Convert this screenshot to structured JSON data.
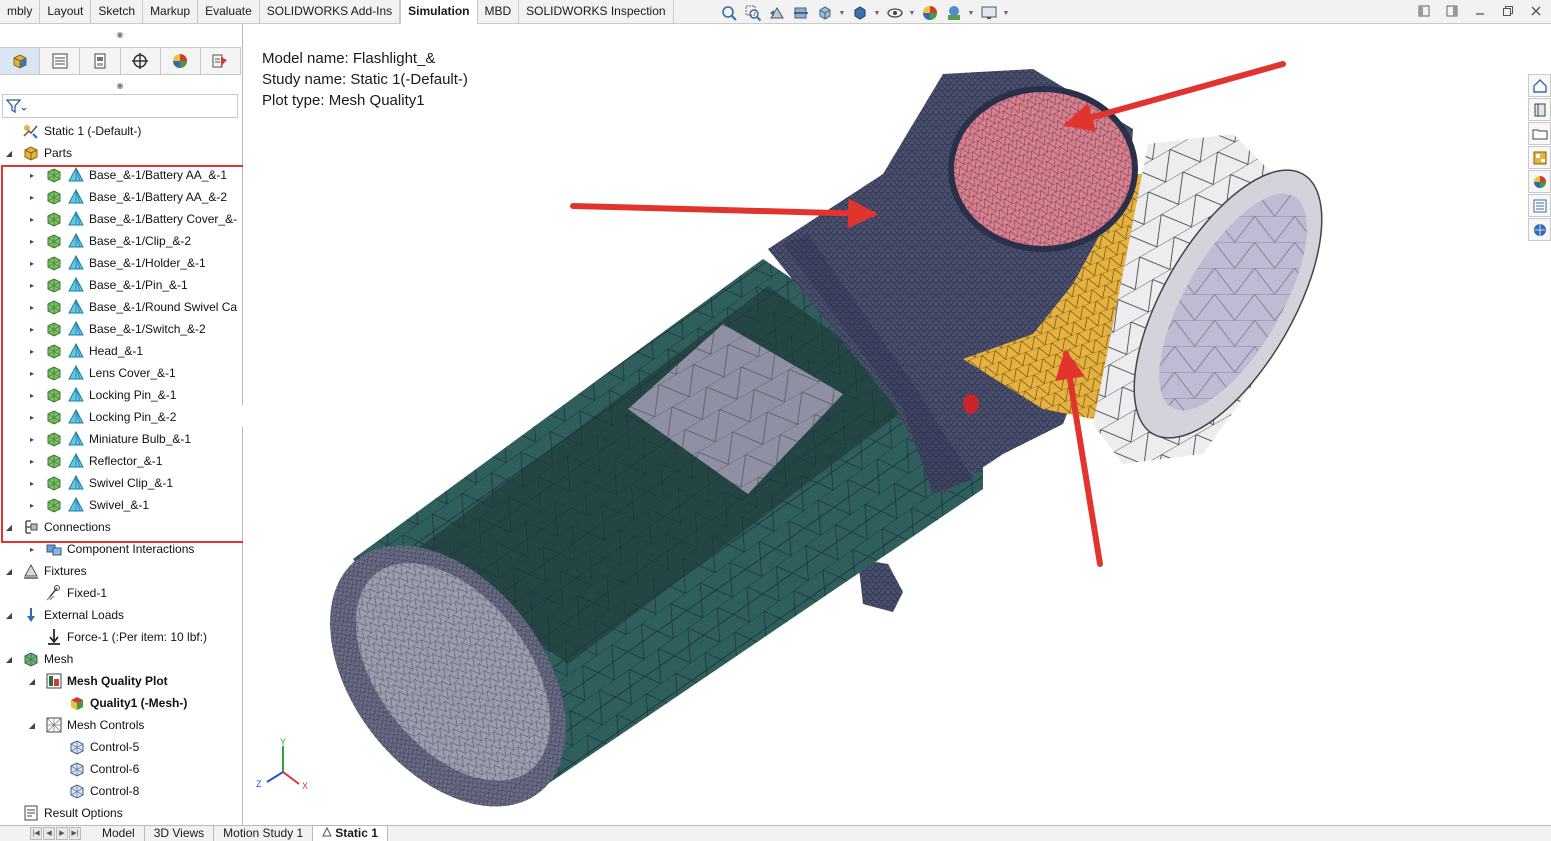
{
  "ribbon": {
    "tabs": [
      {
        "label": "mbly"
      },
      {
        "label": "Layout"
      },
      {
        "label": "Sketch"
      },
      {
        "label": "Markup"
      },
      {
        "label": "Evaluate"
      },
      {
        "label": "SOLIDWORKS Add-Ins"
      },
      {
        "label": "Simulation",
        "active": true
      },
      {
        "label": "MBD"
      },
      {
        "label": "SOLIDWORKS Inspection"
      }
    ]
  },
  "tree": {
    "rows": [
      {
        "label": "Static 1 (-Default-)",
        "depth": 0,
        "expander": "none",
        "icon": "study-icon"
      },
      {
        "label": "Parts",
        "depth": 0,
        "expander": "open",
        "icon": "parts-folder-icon"
      },
      {
        "label": "Base_&-1/Battery AA_&-1",
        "depth": 1,
        "expander": "closed",
        "icon": "solid-body-icon"
      },
      {
        "label": "Base_&-1/Battery AA_&-2",
        "depth": 1,
        "expander": "closed",
        "icon": "solid-body-icon"
      },
      {
        "label": "Base_&-1/Battery Cover_&-",
        "depth": 1,
        "expander": "closed",
        "icon": "solid-body-icon"
      },
      {
        "label": "Base_&-1/Clip_&-2",
        "depth": 1,
        "expander": "closed",
        "icon": "solid-body-icon"
      },
      {
        "label": "Base_&-1/Holder_&-1",
        "depth": 1,
        "expander": "closed",
        "icon": "solid-body-icon"
      },
      {
        "label": "Base_&-1/Pin_&-1",
        "depth": 1,
        "expander": "closed",
        "icon": "solid-body-icon"
      },
      {
        "label": "Base_&-1/Round Swivel Ca",
        "depth": 1,
        "expander": "closed",
        "icon": "solid-body-icon"
      },
      {
        "label": "Base_&-1/Switch_&-2",
        "depth": 1,
        "expander": "closed",
        "icon": "solid-body-icon"
      },
      {
        "label": "Head_&-1",
        "depth": 1,
        "expander": "closed",
        "icon": "solid-body-icon"
      },
      {
        "label": "Lens Cover_&-1",
        "depth": 1,
        "expander": "closed",
        "icon": "solid-body-icon"
      },
      {
        "label": "Locking Pin_&-1",
        "depth": 1,
        "expander": "closed",
        "icon": "solid-body-icon"
      },
      {
        "label": "Locking Pin_&-2",
        "depth": 1,
        "expander": "closed",
        "icon": "solid-body-icon"
      },
      {
        "label": "Miniature Bulb_&-1",
        "depth": 1,
        "expander": "closed",
        "icon": "solid-body-icon"
      },
      {
        "label": "Reflector_&-1",
        "depth": 1,
        "expander": "closed",
        "icon": "solid-body-icon"
      },
      {
        "label": "Swivel Clip_&-1",
        "depth": 1,
        "expander": "closed",
        "icon": "solid-body-icon"
      },
      {
        "label": "Swivel_&-1",
        "depth": 1,
        "expander": "closed",
        "icon": "solid-body-icon"
      },
      {
        "label": "Connections",
        "depth": 0,
        "expander": "open",
        "icon": "connections-icon"
      },
      {
        "label": "Component Interactions",
        "depth": 1,
        "expander": "closed",
        "icon": "component-interaction-icon"
      },
      {
        "label": "Fixtures",
        "depth": 0,
        "expander": "open",
        "icon": "fixtures-icon"
      },
      {
        "label": "Fixed-1",
        "depth": 1,
        "expander": "none",
        "icon": "fixed-icon"
      },
      {
        "label": "External Loads",
        "depth": 0,
        "expander": "open",
        "icon": "external-loads-icon"
      },
      {
        "label": "Force-1 (:Per item: 10 lbf:)",
        "depth": 1,
        "expander": "none",
        "icon": "force-icon"
      },
      {
        "label": "Mesh",
        "depth": 0,
        "expander": "open",
        "icon": "mesh-icon"
      },
      {
        "label": "Mesh Quality Plot",
        "depth": 1,
        "expander": "open",
        "icon": "mesh-quality-plot-icon",
        "bold": true
      },
      {
        "label": "Quality1 (-Mesh-)",
        "depth": 2,
        "expander": "none",
        "icon": "quality-plot-icon",
        "bold": true
      },
      {
        "label": "Mesh Controls",
        "depth": 1,
        "expander": "open",
        "icon": "mesh-controls-icon"
      },
      {
        "label": "Control-5",
        "depth": 2,
        "expander": "none",
        "icon": "mesh-control-icon"
      },
      {
        "label": "Control-6",
        "depth": 2,
        "expander": "none",
        "icon": "mesh-control-icon"
      },
      {
        "label": "Control-8",
        "depth": 2,
        "expander": "none",
        "icon": "mesh-control-icon"
      },
      {
        "label": "Result Options",
        "depth": 0,
        "expander": "none",
        "icon": "result-options-icon"
      }
    ]
  },
  "viewport": {
    "model_name": "Model name: Flashlight_&",
    "study_name": "Study name: Static 1(-Default-)",
    "plot_type": "Plot type: Mesh Quality1",
    "triad": {
      "x": "X",
      "y": "Y",
      "z": "Z"
    }
  },
  "bottom_tabs": [
    {
      "label": "Model"
    },
    {
      "label": "3D Views"
    },
    {
      "label": "Motion Study 1"
    },
    {
      "label": "Static 1",
      "active": true
    }
  ],
  "colors": {
    "highlight_red": "#e2342f",
    "mesh_teal": "#2f5f5d",
    "mesh_navy": "#4b516c",
    "mesh_pink": "#d7808f",
    "mesh_gold": "#e5b240",
    "mesh_white": "#ededf0",
    "lens_gray": "#bdbcd4"
  }
}
